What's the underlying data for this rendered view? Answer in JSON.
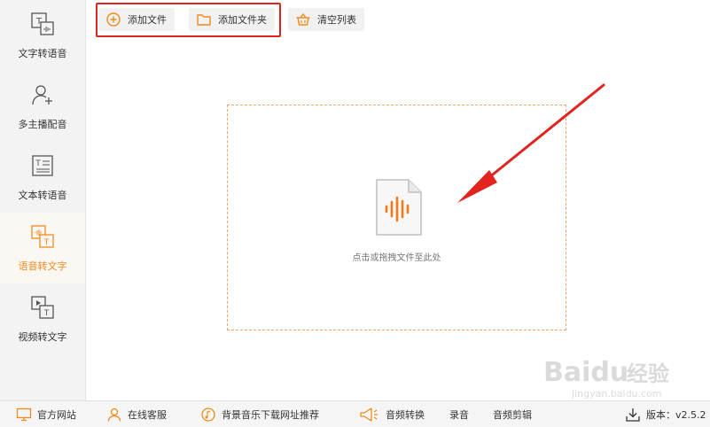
{
  "sidebar": {
    "items": [
      {
        "label": "文字转语音",
        "icon": "text-to-speech-icon",
        "active": false
      },
      {
        "label": "多主播配音",
        "icon": "add-user-icon",
        "active": false
      },
      {
        "label": "文本转语音",
        "icon": "document-text-icon",
        "active": false
      },
      {
        "label": "语音转文字",
        "icon": "speech-to-text-icon",
        "active": true
      },
      {
        "label": "视频转文字",
        "icon": "video-to-text-icon",
        "active": false
      }
    ]
  },
  "toolbar": {
    "add_file_label": "添加文件",
    "add_folder_label": "添加文件夹",
    "clear_list_label": "清空列表"
  },
  "dropzone": {
    "hint": "点击或拖拽文件至此处"
  },
  "footer": {
    "website_label": "官方网站",
    "support_label": "在线客服",
    "music_label": "背景音乐下载网址推荐",
    "audio_convert_label": "音频转换",
    "record_label": "录音",
    "audio_edit_label": "音频剪辑",
    "version_label": "版本：v2.5.2"
  },
  "watermark": {
    "brand": "Baidu",
    "brand_cn": "经验",
    "url": "jingyan.baidu.com"
  },
  "colors": {
    "accent": "#f08a1c",
    "highlight_red": "#e3231d",
    "dashed_border": "#f2a36a"
  }
}
